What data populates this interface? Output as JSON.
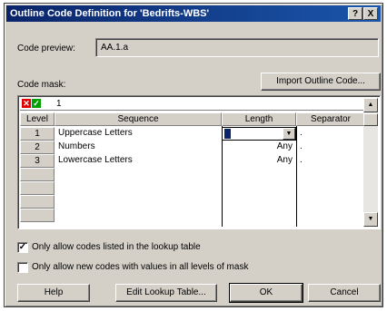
{
  "window": {
    "title": "Outline Code Definition for 'Bedrifts-WBS'",
    "help_glyph": "?",
    "close_glyph": "X"
  },
  "code_preview": {
    "label": "Code preview:",
    "value": "AA.1.a"
  },
  "code_mask": {
    "label": "Code mask:",
    "import_button": "Import Outline Code...",
    "edit_value": "1",
    "columns": [
      "Level",
      "Sequence",
      "Length",
      "Separator"
    ],
    "rows": [
      {
        "level": "1",
        "sequence": "Uppercase Letters",
        "length": "1",
        "separator": "."
      },
      {
        "level": "2",
        "sequence": "Numbers",
        "length": "Any",
        "separator": "."
      },
      {
        "level": "3",
        "sequence": "Lowercase Letters",
        "length": "Any",
        "separator": "."
      }
    ]
  },
  "options": {
    "lookup_only": {
      "label": "Only allow codes listed in the lookup table",
      "checked": true
    },
    "all_levels": {
      "label": "Only allow new codes with values in all levels of mask",
      "checked": false
    }
  },
  "buttons": {
    "help": "Help",
    "edit_lookup": "Edit Lookup Table...",
    "ok": "OK",
    "cancel": "Cancel"
  },
  "icons": {
    "cancel_edit": "x-icon",
    "accept_edit": "check-icon"
  }
}
